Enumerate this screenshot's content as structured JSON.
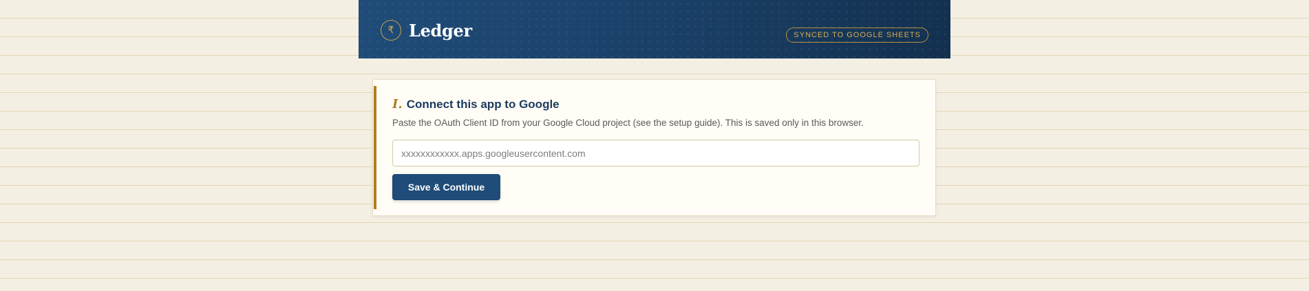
{
  "header": {
    "brand_symbol": "₹",
    "brand_title": "Ledger",
    "sync_status": "SYNCED TO GOOGLE SHEETS"
  },
  "card": {
    "step_number": "I.",
    "title": "Connect this app to Google",
    "description": "Paste the OAuth Client ID from your Google Cloud project (see the setup guide). This is saved only in this browser.",
    "client_id_input": {
      "value": "",
      "placeholder": "xxxxxxxxxxxx.apps.googleusercontent.com"
    },
    "save_button_label": "Save & Continue"
  },
  "colors": {
    "header_bg": "#1f4c78",
    "accent_gold": "#b07d22",
    "primary_button": "#1f4c78",
    "page_bg": "#f4efe3"
  },
  "icons": {
    "brand": "rupee-icon"
  }
}
